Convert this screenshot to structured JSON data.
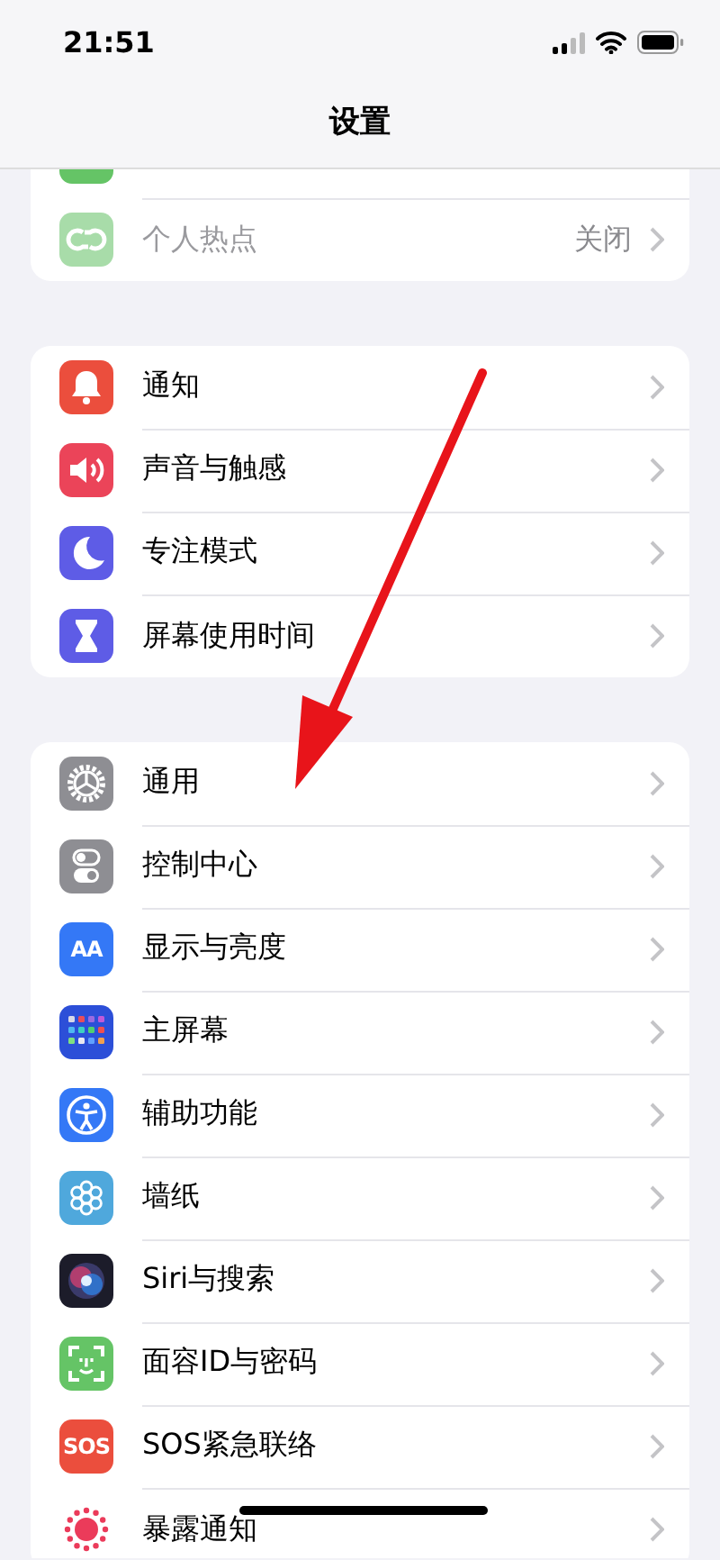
{
  "status_bar": {
    "time": "21:51"
  },
  "title": "设置",
  "groups": [
    {
      "items": [
        {
          "kind": "cellular",
          "color": "#65c466"
        },
        {
          "kind": "hotspot",
          "color": "#a8dca9",
          "label": "个人热点",
          "value": "关闭",
          "disabled": true
        }
      ]
    },
    {
      "items": [
        {
          "kind": "bell",
          "color": "#eb4e3d",
          "label": "通知",
          "disabled": false
        },
        {
          "kind": "speaker",
          "color": "#eb4459",
          "label": "声音与触感",
          "disabled": false
        },
        {
          "kind": "moon",
          "color": "#5e5ce6",
          "label": "专注模式",
          "disabled": false
        },
        {
          "kind": "hourglass",
          "color": "#5e5ce6",
          "label": "屏幕使用时间",
          "disabled": false
        }
      ]
    },
    {
      "items": [
        {
          "kind": "gear",
          "color": "#8e8e93",
          "label": "通用",
          "disabled": false
        },
        {
          "kind": "toggles",
          "color": "#8e8e93",
          "label": "控制中心",
          "disabled": false
        },
        {
          "kind": "text",
          "icon_text": "AA",
          "color": "#3478f6",
          "label": "显示与亮度",
          "disabled": false
        },
        {
          "kind": "grid",
          "color": "#2c4fd8",
          "label": "主屏幕",
          "disabled": false
        },
        {
          "kind": "person",
          "color": "#3478f6",
          "label": "辅助功能",
          "disabled": false
        },
        {
          "kind": "flower",
          "color": "#4fa8dc",
          "label": "墙纸",
          "disabled": false
        },
        {
          "kind": "orb",
          "color": "#1c1c2a",
          "label": "Siri与搜索",
          "disabled": false
        },
        {
          "kind": "face",
          "color": "#65c466",
          "label": "面容ID与密码",
          "disabled": false
        },
        {
          "kind": "text",
          "icon_text": "SOS",
          "color": "#eb4e3d",
          "label": "SOS紧急联络",
          "disabled": false
        },
        {
          "kind": "exposure",
          "color": "#ffffff",
          "label": "暴露通知",
          "disabled": false
        }
      ]
    }
  ],
  "annotations": [
    {
      "kind": "arrow",
      "color": "#e8141a"
    }
  ]
}
